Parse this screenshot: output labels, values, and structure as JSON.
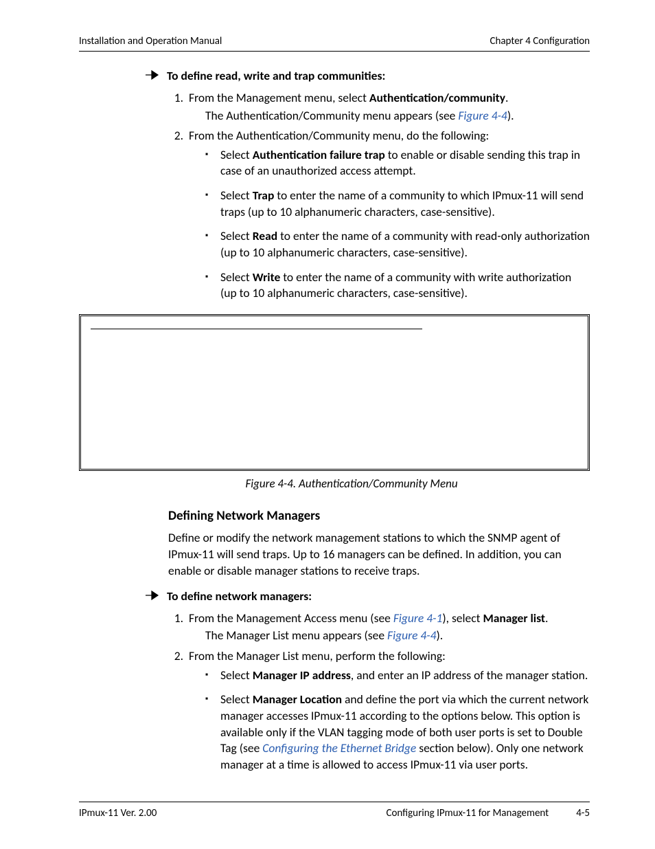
{
  "header": {
    "left": "Installation and Operation Manual",
    "right": "Chapter 4  Configuration"
  },
  "proc1": {
    "title": "To define read, write and trap communities:",
    "step1_a": "From the Management menu, select ",
    "step1_b": "Authentication/community",
    "step1_c": ".",
    "step1_result_a": "The Authentication/Community menu appears (see ",
    "step1_result_link": "Figure 4-4",
    "step1_result_b": ").",
    "step2": "From the Authentication/Community menu, do the following:",
    "b1_a": "Select ",
    "b1_b": "Authentication failure trap",
    "b1_c": " to enable or disable sending this trap in case of an unauthorized access attempt.",
    "b2_a": "Select ",
    "b2_b": "Trap",
    "b2_c": " to enter the name of a community to which IPmux-11 will send traps (up to 10 alphanumeric characters, case-sensitive).",
    "b3_a": "Select ",
    "b3_b": "Read",
    "b3_c": " to enter the name of a community with read-only authorization (up to 10 alphanumeric characters, case-sensitive).",
    "b4_a": "Select ",
    "b4_b": "Write",
    "b4_c": " to enter the name of a community with write authorization (up to 10 alphanumeric characters, case-sensitive)."
  },
  "figure_caption": "Figure 4-4.  Authentication/Community Menu",
  "section2_title": "Defining Network Managers",
  "section2_para": "Define or modify the network management stations to which the SNMP agent of IPmux-11 will send traps. Up to 16 managers can be defined. In addition, you can enable or disable manager stations to receive traps.",
  "proc2": {
    "title": "To define network managers:",
    "step1_a": "From the Management Access menu (see ",
    "step1_link": "Figure 4-1",
    "step1_b": "), select ",
    "step1_c": "Manager list",
    "step1_d": ".",
    "step1_result_a": "The Manager List menu appears (see ",
    "step1_result_link": "Figure 4-4",
    "step1_result_b": ").",
    "step2": "From the Manager List menu, perform the following:",
    "b1_a": "Select ",
    "b1_b": "Manager IP address",
    "b1_c": ", and enter an IP address of the manager station.",
    "b2_a": "Select ",
    "b2_b": "Manager Location",
    "b2_c": " and define the port via which the current network manager accesses IPmux-11 according to the options below. This option is available only if the VLAN tagging mode of both user ports is set to Double Tag (see ",
    "b2_link": "Configuring the Ethernet Bridge",
    "b2_d": " section below). Only one network manager at a time is allowed to access IPmux-11 via user ports."
  },
  "footer": {
    "left": "IPmux-11 Ver. 2.00",
    "center": "Configuring IPmux-11 for Management",
    "page": "4-5"
  }
}
